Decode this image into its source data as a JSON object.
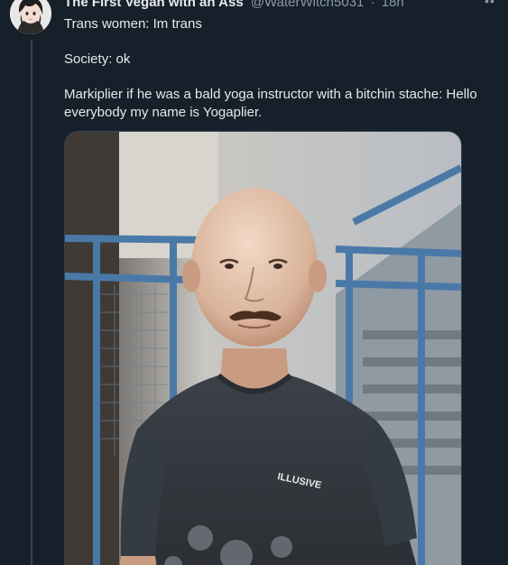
{
  "tweet": {
    "author": {
      "display_name": "The First Vegan with an Ass",
      "handle": "@WaterWitch5031",
      "separator": "·",
      "timestamp": "18h"
    },
    "text": {
      "line1": "Trans women: Im trans",
      "line2": "Society: ok",
      "line3": "Markiplier if he was a bald yoga instructor with a bitchin stache: Hello everybody my name is Yogaplier."
    },
    "media": {
      "shirt_text": "ILLUSIVE"
    },
    "icons": {
      "more": "more-options-icon",
      "avatar": "anime-avatar"
    },
    "colors": {
      "background": "#15202b",
      "text": "#e7e9ea",
      "secondary": "#8b98a5",
      "border": "#38444d"
    }
  }
}
